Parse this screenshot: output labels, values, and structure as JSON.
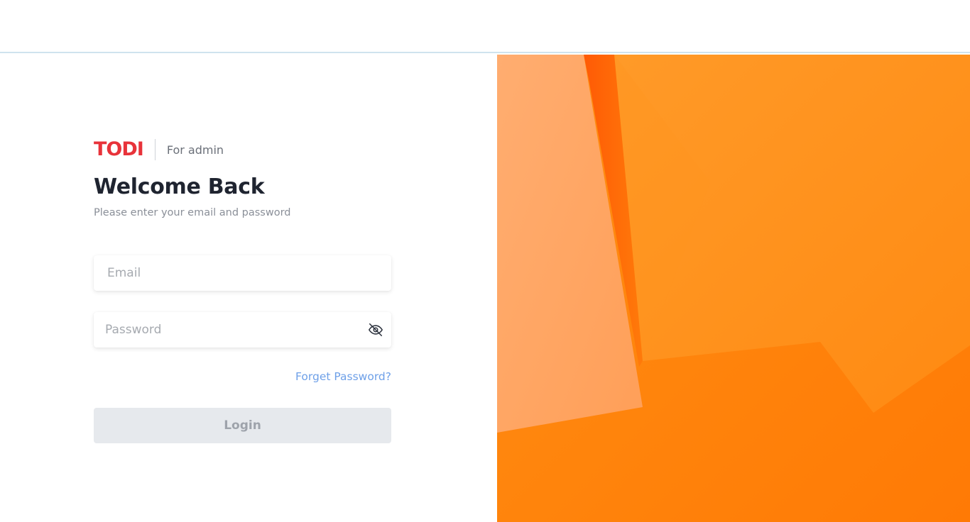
{
  "brand": {
    "logo_text": "TODI",
    "audience": "For admin",
    "logo_color": "#e8333a"
  },
  "heading": {
    "title": "Welcome Back",
    "subtitle": "Please enter your email and password"
  },
  "form": {
    "email": {
      "value": "",
      "placeholder": "Email"
    },
    "password": {
      "value": "",
      "placeholder": "Password",
      "toggle_icon": "eye-off-icon"
    },
    "forgot_label": "Forget Password?",
    "login_label": "Login"
  },
  "colors": {
    "accent_link": "#6ea0e8",
    "button_disabled_bg": "#e6e9ed",
    "hero_orange": "#ff8a10"
  }
}
